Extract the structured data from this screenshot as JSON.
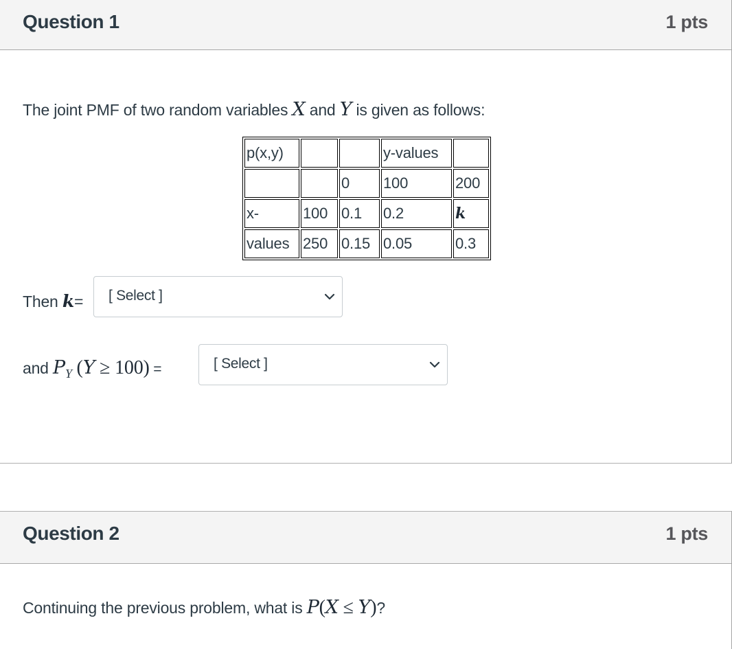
{
  "questions": [
    {
      "title": "Question 1",
      "points": "1 pts",
      "intro": {
        "before_x": "The joint PMF of two random variables ",
        "var_x": "X",
        "between": " and ",
        "var_y": "Y",
        "after_y": " is given as follows:"
      },
      "table": {
        "rows": [
          [
            "p(x,y)",
            "",
            "",
            "y-values",
            ""
          ],
          [
            "",
            "",
            "0",
            "100",
            "200"
          ],
          [
            "x-",
            "100",
            "0.1",
            "0.2",
            "k"
          ],
          [
            "values",
            "250",
            "0.15",
            "0.05",
            "0.3"
          ]
        ]
      },
      "part_k": {
        "prefix": "Then ",
        "var": "k",
        "suffix": "=",
        "select": {
          "selected": "[ Select ]"
        }
      },
      "part_py": {
        "prefix": "and ",
        "p": "P",
        "sub": "Y",
        "open": " (",
        "var": "Y",
        "op": " ≥ ",
        "value": "100",
        "close": ")",
        "suffix": " =",
        "select": {
          "selected": "[ Select ]"
        }
      }
    },
    {
      "title": "Question 2",
      "points": "1 pts",
      "text": {
        "before": "Continuing the previous problem, what is ",
        "p": "P",
        "open": "(",
        "x": "X",
        "op": " ≤ ",
        "y": "Y",
        "close": ")",
        "after": "?"
      }
    }
  ]
}
